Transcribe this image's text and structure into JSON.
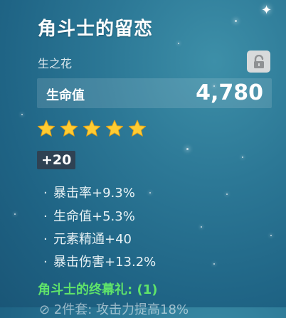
{
  "artifact": {
    "name": "角斗士的留恋",
    "slot": "生之花",
    "main_stat": {
      "name": "生命值",
      "value": "4,780"
    },
    "rarity_stars": 5,
    "level": "+20",
    "substats": [
      {
        "bullet": "·",
        "text": "暴击率+9.3%"
      },
      {
        "bullet": "·",
        "text": "生命值+5.3%"
      },
      {
        "bullet": "·",
        "text": "元素精通+40"
      },
      {
        "bullet": "·",
        "text": "暴击伤害+13.2%"
      }
    ],
    "set": {
      "name": "角斗士的终幕礼: (1)",
      "bonus": "⊘ 2件套: 攻击力提高18%"
    }
  },
  "colors": {
    "set_name": "#5fe36a",
    "star": "#ffcc32",
    "lock_bg": "#d8dadb"
  },
  "icons": {
    "lock": "lock-open-icon",
    "star": "star-icon",
    "sparkle": "sparkle-icon"
  }
}
